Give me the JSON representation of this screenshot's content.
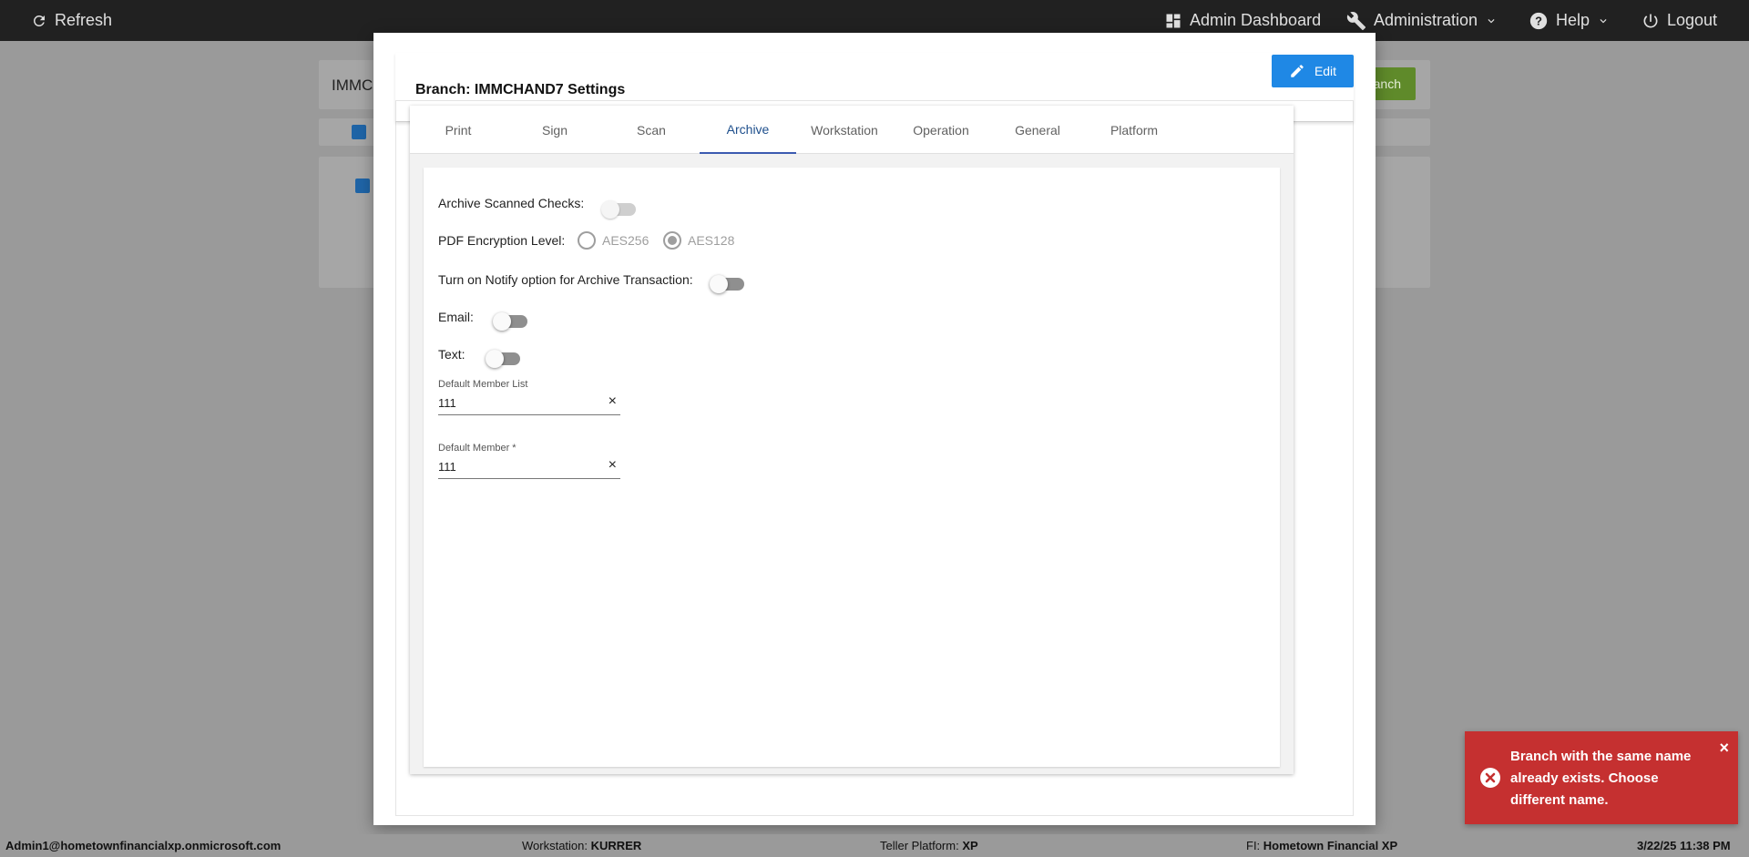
{
  "topbar": {
    "refresh_label": "Refresh",
    "admin_dashboard_label": "Admin Dashboard",
    "administration_label": "Administration",
    "help_label": "Help",
    "logout_label": "Logout"
  },
  "background": {
    "search_value": "IMMC",
    "add_button_partial": "anch"
  },
  "modal": {
    "title": "Branch: IMMCHAND7 Settings",
    "edit_label": "Edit",
    "tabs": [
      {
        "label": "Print"
      },
      {
        "label": "Sign"
      },
      {
        "label": "Scan"
      },
      {
        "label": "Archive",
        "active": true
      },
      {
        "label": "Workstation"
      },
      {
        "label": "Operation"
      },
      {
        "label": "General"
      },
      {
        "label": "Platform"
      }
    ],
    "archive": {
      "archive_scanned_checks_label": "Archive Scanned Checks:",
      "archive_scanned_checks_on": false,
      "pdf_encryption_label": "PDF Encryption Level:",
      "encryption_options": [
        "AES256",
        "AES128"
      ],
      "encryption_selected": "AES128",
      "notify_label": "Turn on Notify option for Archive Transaction:",
      "notify_on": false,
      "email_label": "Email:",
      "email_on": false,
      "text_label": "Text:",
      "text_on": false,
      "default_member_list_label": "Default Member List",
      "default_member_list_value": "111",
      "default_member_label": "Default Member *",
      "default_member_value": "111"
    }
  },
  "toast": {
    "message": "Branch with the same name already exists. Choose different name.",
    "close_glyph": "×",
    "color": "#c53030"
  },
  "footer": {
    "user": "Admin1@hometownfinancialxp.onmicrosoft.com",
    "workstation_label": "Workstation:",
    "workstation_value": "KURRER",
    "teller_platform_label": "Teller Platform:",
    "teller_platform_value": "XP",
    "fi_label": "FI:",
    "fi_value": "Hometown Financial XP",
    "datetime": "3/22/25 11:38 PM"
  },
  "colors": {
    "accent": "#1f88e5",
    "topbar": "#212121",
    "active_tab": "#3b5ab0"
  }
}
